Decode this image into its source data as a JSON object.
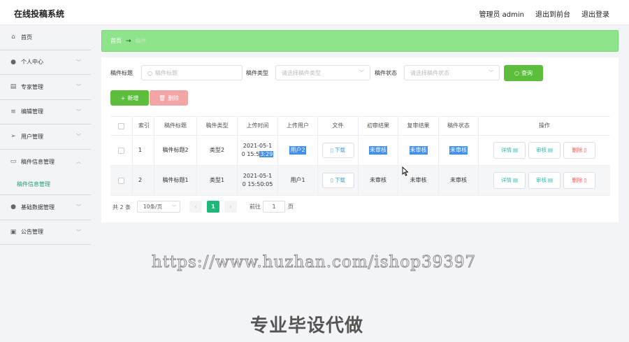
{
  "app": {
    "title": "在线投稿系统"
  },
  "header": {
    "admin": "管理员 admin",
    "back_front": "退出到前台",
    "logout": "退出登录"
  },
  "sidebar": {
    "items": [
      {
        "label": "首页",
        "icon": "home-icon"
      },
      {
        "label": "个人中心",
        "icon": "user-icon"
      },
      {
        "label": "专家管理",
        "icon": "expert-icon"
      },
      {
        "label": "编辑管理",
        "icon": "edit-icon"
      },
      {
        "label": "用户管理",
        "icon": "send-icon"
      },
      {
        "label": "稿件信息管理",
        "icon": "chat-icon"
      },
      {
        "label": "基础数据管理",
        "icon": "user-icon"
      },
      {
        "label": "公告管理",
        "icon": "briefcase-icon"
      }
    ],
    "submenu": {
      "label": "稿件信息管理"
    }
  },
  "breadcrumb": {
    "home": "首页",
    "current": "稿件"
  },
  "search": {
    "title_label": "稿件标题",
    "title_placeholder": "稿件标题",
    "type_label": "稿件类型",
    "type_placeholder": "请选择稿件类型",
    "status_label": "稿件状态",
    "status_placeholder": "请选择稿件状态",
    "query_button": "查询"
  },
  "actions": {
    "add": "新增",
    "delete": "删除"
  },
  "table": {
    "headers": [
      "索引",
      "稿件标题",
      "稿件类型",
      "上传时间",
      "上传用户",
      "文件",
      "初审结果",
      "复审结果",
      "稿件状态",
      "操作"
    ],
    "rows": [
      {
        "index": "1",
        "title": "稿件标题2",
        "type": "类型2",
        "time_line1": "2021-05-1",
        "time_line2a": "0 15:5",
        "time_line2b": "3:29",
        "user": "用户2",
        "file": "下载",
        "first": "未审核",
        "second": "未审核",
        "status": "未审核"
      },
      {
        "index": "2",
        "title": "稿件标题1",
        "type": "类型1",
        "time_line1": "2021-05-1",
        "time_line2a": "0 15:50:05",
        "time_line2b": "",
        "user": "用户1",
        "file": "下载",
        "first": "未审核",
        "second": "未审核",
        "status": "未审核"
      }
    ],
    "ops": {
      "detail": "详情",
      "review": "审核",
      "delete": "删除"
    }
  },
  "pagination": {
    "total": "共 2 条",
    "page_size": "10条/页",
    "current": "1",
    "goto": "前往",
    "goto_value": "1",
    "page_unit": "页"
  },
  "watermark": "https://www.huzhan.com/ishop39397",
  "bottom_text": "专业毕设代做"
}
